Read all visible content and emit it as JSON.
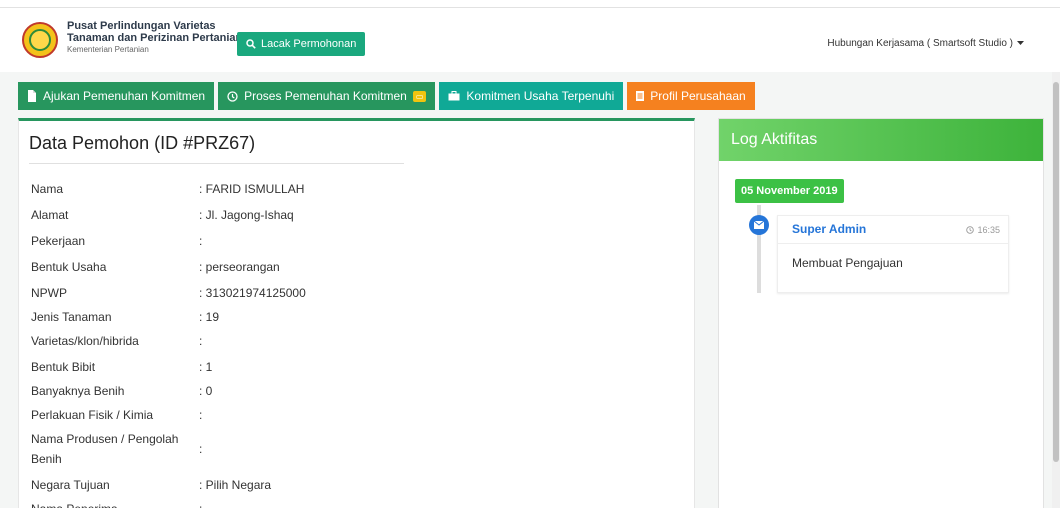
{
  "header": {
    "org_line1": "Pusat Perlindungan Varietas",
    "org_line2": "Tanaman dan Perizinan Pertanian",
    "org_line3": "Kementerian Pertanian",
    "track_button": "Lacak Permohonan",
    "user_menu": "Hubungan Kerjasama ( Smartsoft Studio )"
  },
  "tabs": [
    {
      "label": "Ajukan Pemenuhan Komitmen"
    },
    {
      "label": "Proses Pemenuhan Komitmen"
    },
    {
      "label": "Komitmen Usaha Terpenuhi"
    },
    {
      "label": "Profil Perusahaan"
    }
  ],
  "applicant": {
    "title": "Data Pemohon (ID #PRZ67)",
    "fields": [
      {
        "label": "Nama",
        "value": ": FARID ISMULLAH"
      },
      {
        "label": "Alamat",
        "value": ": Jl. Jagong-Ishaq"
      },
      {
        "label": "Pekerjaan",
        "value": ":"
      },
      {
        "label": "Bentuk Usaha",
        "value": ": perseorangan"
      },
      {
        "label": "NPWP",
        "value": ": 313021974125000"
      },
      {
        "label": "Jenis Tanaman",
        "value": ": 19"
      },
      {
        "label": "Varietas/klon/hibrida",
        "value": ":"
      },
      {
        "label": "Bentuk Bibit",
        "value": ": 1"
      },
      {
        "label": "Banyaknya Benih",
        "value": ": 0"
      },
      {
        "label": "Perlakuan Fisik / Kimia",
        "value": ":"
      },
      {
        "label": "Nama Produsen / Pengolah Benih",
        "value": ":"
      },
      {
        "label": "Negara Tujuan",
        "value": ": Pilih Negara"
      },
      {
        "label": "Nama Penerima",
        "value": ":"
      }
    ]
  },
  "log": {
    "title": "Log Aktifitas",
    "date": "05 November 2019",
    "entries": [
      {
        "author": "Super Admin",
        "time": "16:35",
        "message": "Membuat Pengajuan"
      }
    ]
  },
  "colors": {
    "primary_green": "#27965e",
    "teal": "#10a996",
    "orange": "#f5811f",
    "log_green": "#3db33b",
    "blue": "#2575d8"
  }
}
